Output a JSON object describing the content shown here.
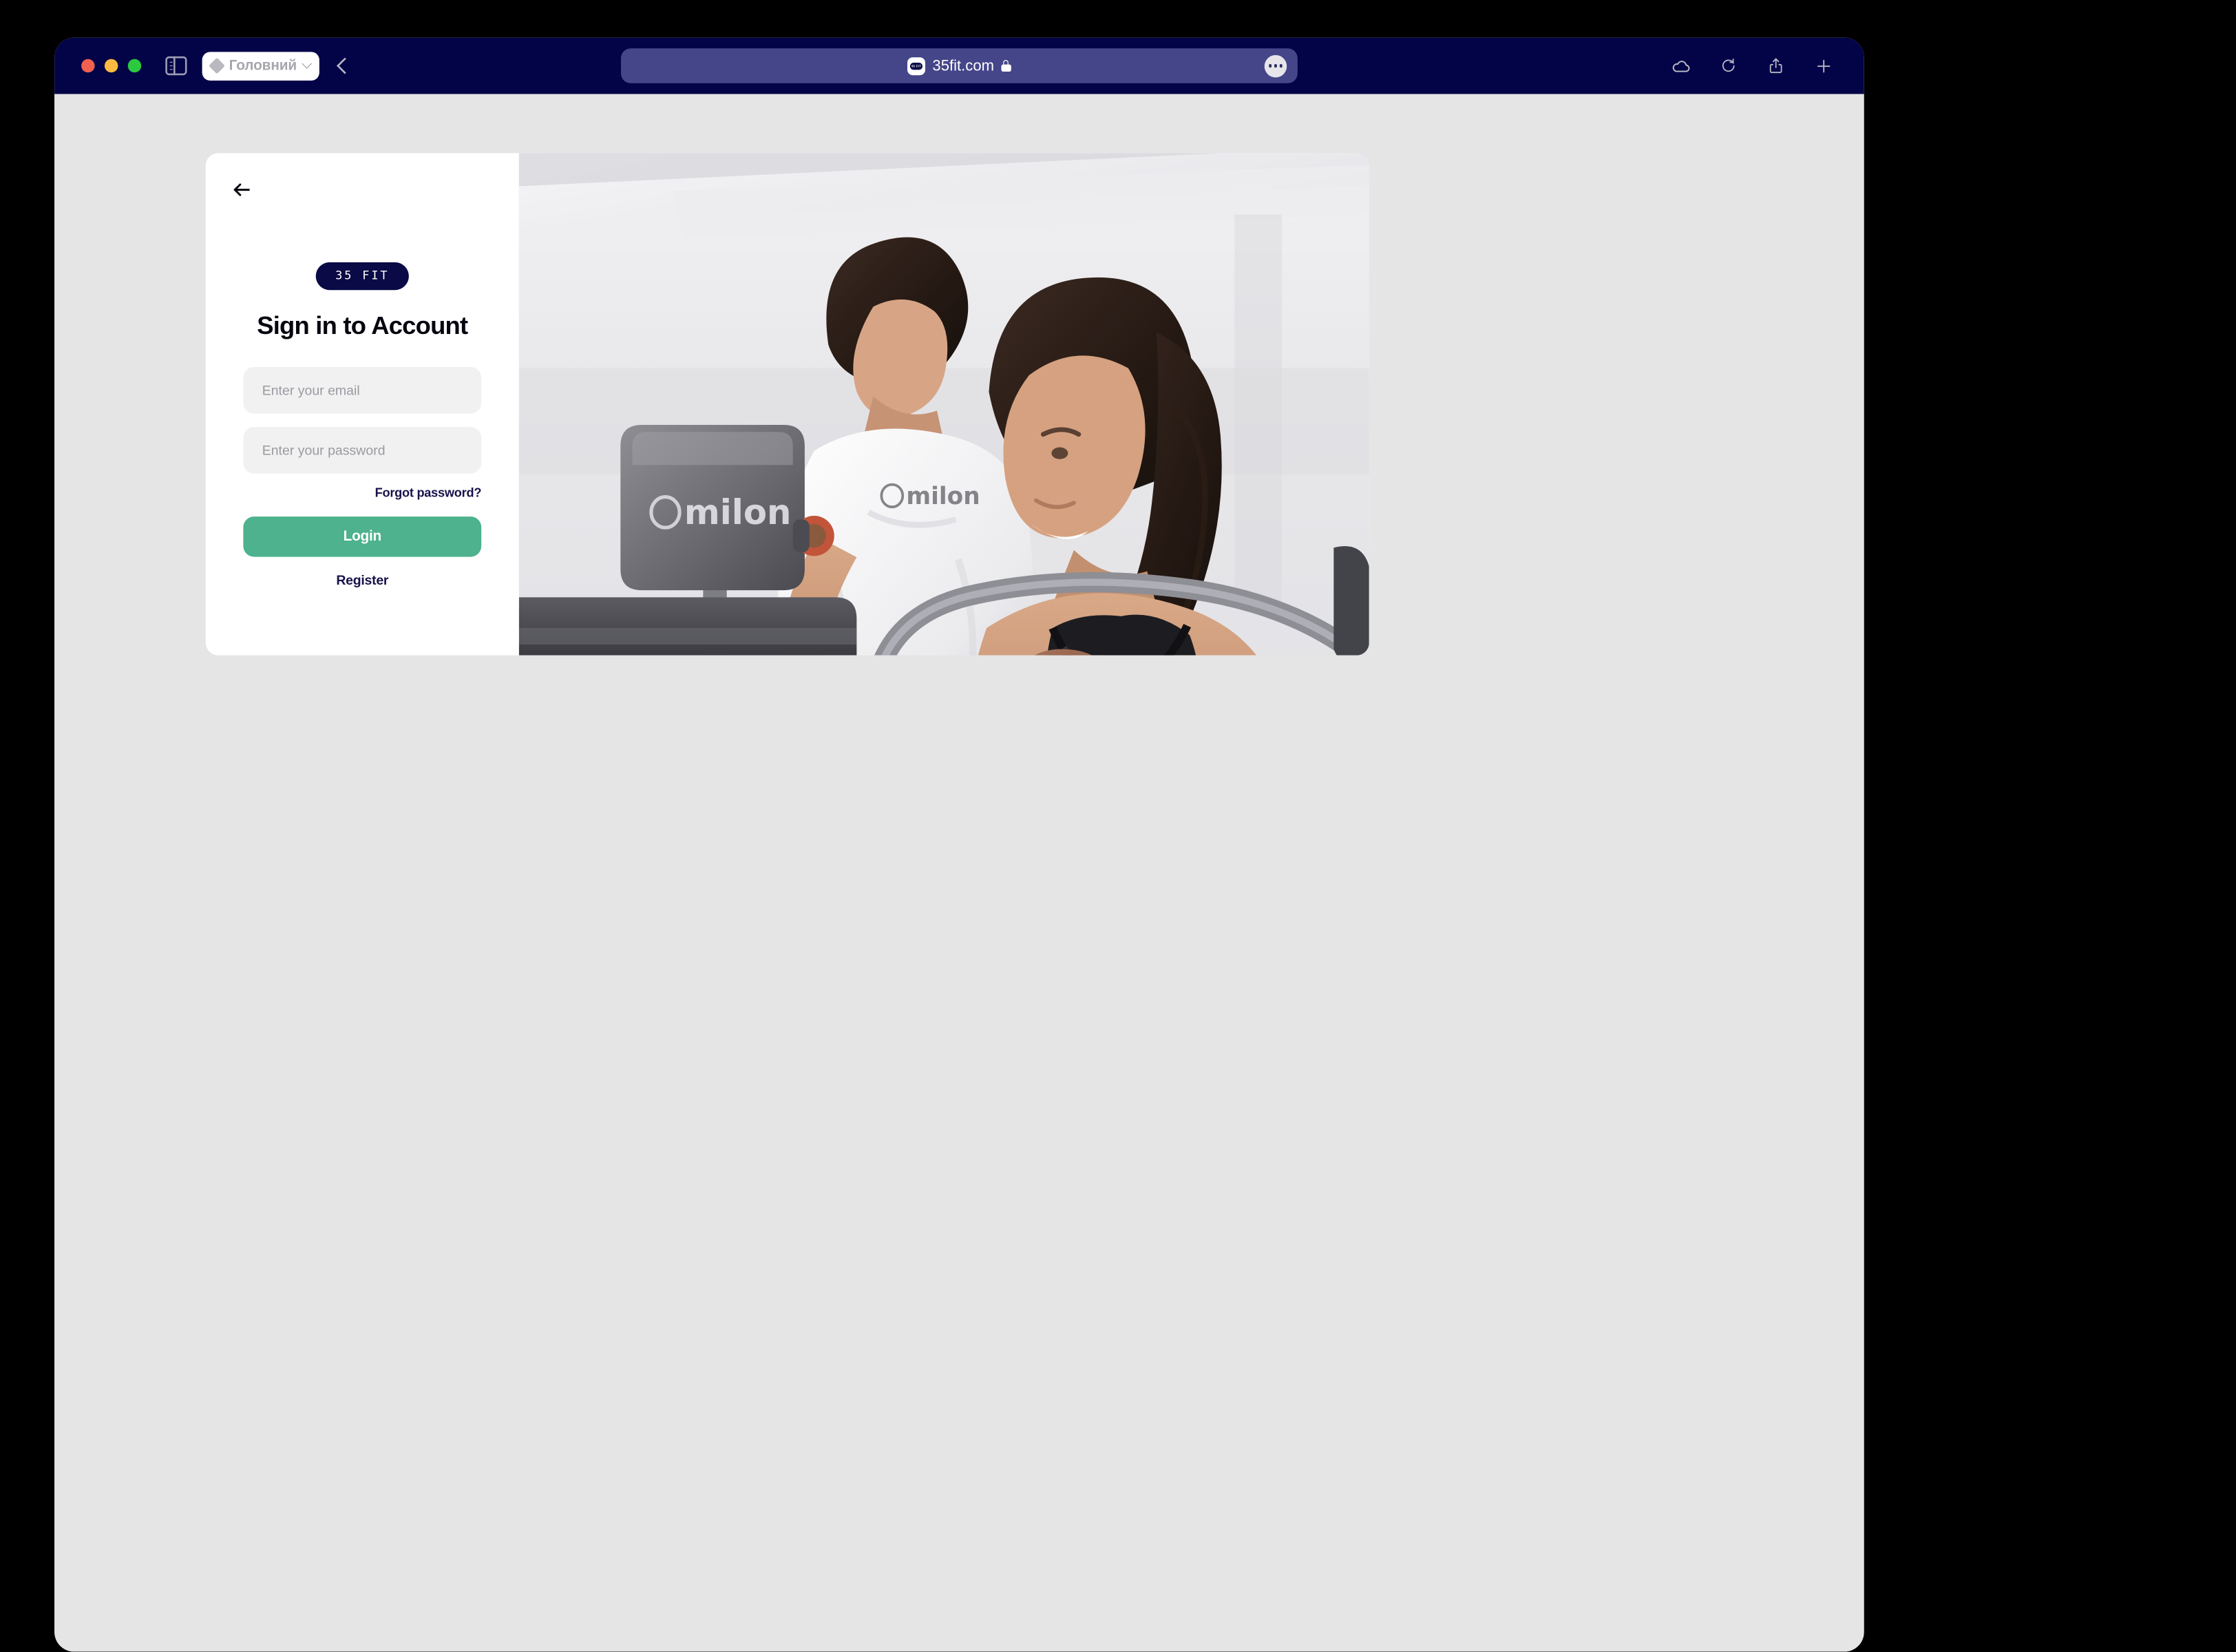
{
  "browser": {
    "traffic_lights": [
      "close",
      "minimize",
      "zoom"
    ],
    "sidebar_toggle_icon": "sidebar-icon",
    "tab": {
      "icon": "diamond-icon",
      "label": "Головний",
      "chevron": "chevron-down-icon"
    },
    "back_icon": "chevron-left-icon",
    "address": {
      "favicon_label": "35 FIT",
      "url": "35fit.com",
      "lock_icon": "lock-icon",
      "menu_icon": "more-options-icon"
    },
    "right_icons": [
      "cloud-icon",
      "reload-icon",
      "share-icon",
      "new-tab-icon"
    ]
  },
  "auth": {
    "back_icon": "arrow-left-icon",
    "brand": "35 FIT",
    "title": "Sign in to Account",
    "email": {
      "placeholder": "Enter your email",
      "value": ""
    },
    "password": {
      "placeholder": "Enter your password",
      "value": ""
    },
    "forgot_label": "Forgot password?",
    "login_label": "Login",
    "register_label": "Register"
  },
  "photo": {
    "alt": "Two women in a gym, trainer assisting a user on a milon strength machine",
    "equipment_brand": "milon",
    "shirt_brand": "milon"
  },
  "colors": {
    "toolbar": "#030347",
    "address_bar": "#45458a",
    "page_bg": "#e5e5e5",
    "brand_navy": "#0a0a46",
    "accent_green": "#4db28d",
    "text_navy": "#18124a",
    "field_bg": "#f1f1f1"
  }
}
